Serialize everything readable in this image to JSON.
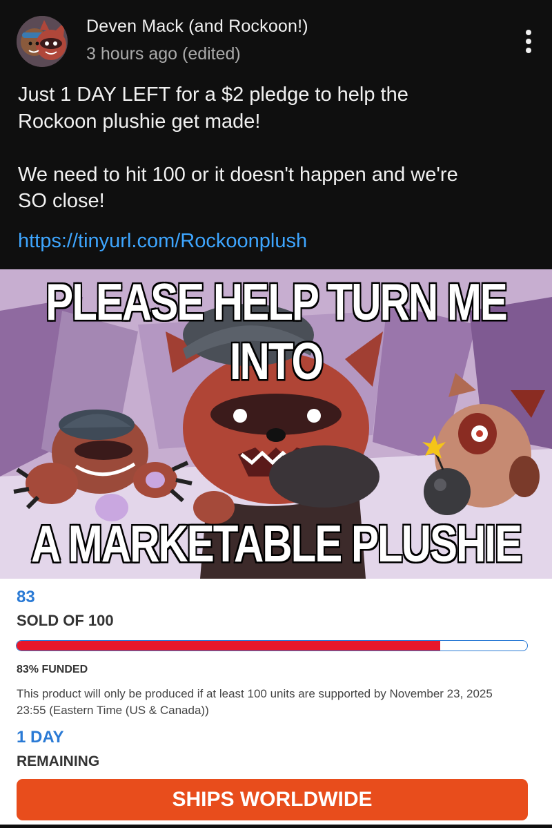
{
  "post": {
    "author": "Deven Mack (and Rockoon!)",
    "timestamp": "3 hours ago (edited)",
    "text": "Just 1 DAY LEFT for a $2 pledge to help the\nRockoon plushie get made!\n\nWe need to hit 100 or it doesn't happen and we're\nSO close!",
    "link": "https://tinyurl.com/Rockoonplush"
  },
  "meme": {
    "top_caption": "PLEASE HELP TURN ME INTO",
    "bottom_caption": "A MARKETABLE PLUSHIE"
  },
  "campaign": {
    "sold": "83",
    "sold_of": "SOLD OF 100",
    "progress_fraction": 0.83,
    "funded": "83% FUNDED",
    "deadline_text": "This product will only be produced if at least 100 units are supported by November 23, 2025 23:55 (Eastern Time (US & Canada))",
    "days": "1 DAY",
    "remaining": "REMAINING",
    "ships_button": "SHIPS WORLDWIDE"
  },
  "colors": {
    "background": "#0f0f0f",
    "link": "#3ea6ff",
    "accent_blue": "#2a7ad5",
    "progress_red": "#e8172a",
    "button_orange": "#e84d1c"
  },
  "icons": {
    "menu": "more-vertical-icon",
    "avatar": "avatar"
  }
}
